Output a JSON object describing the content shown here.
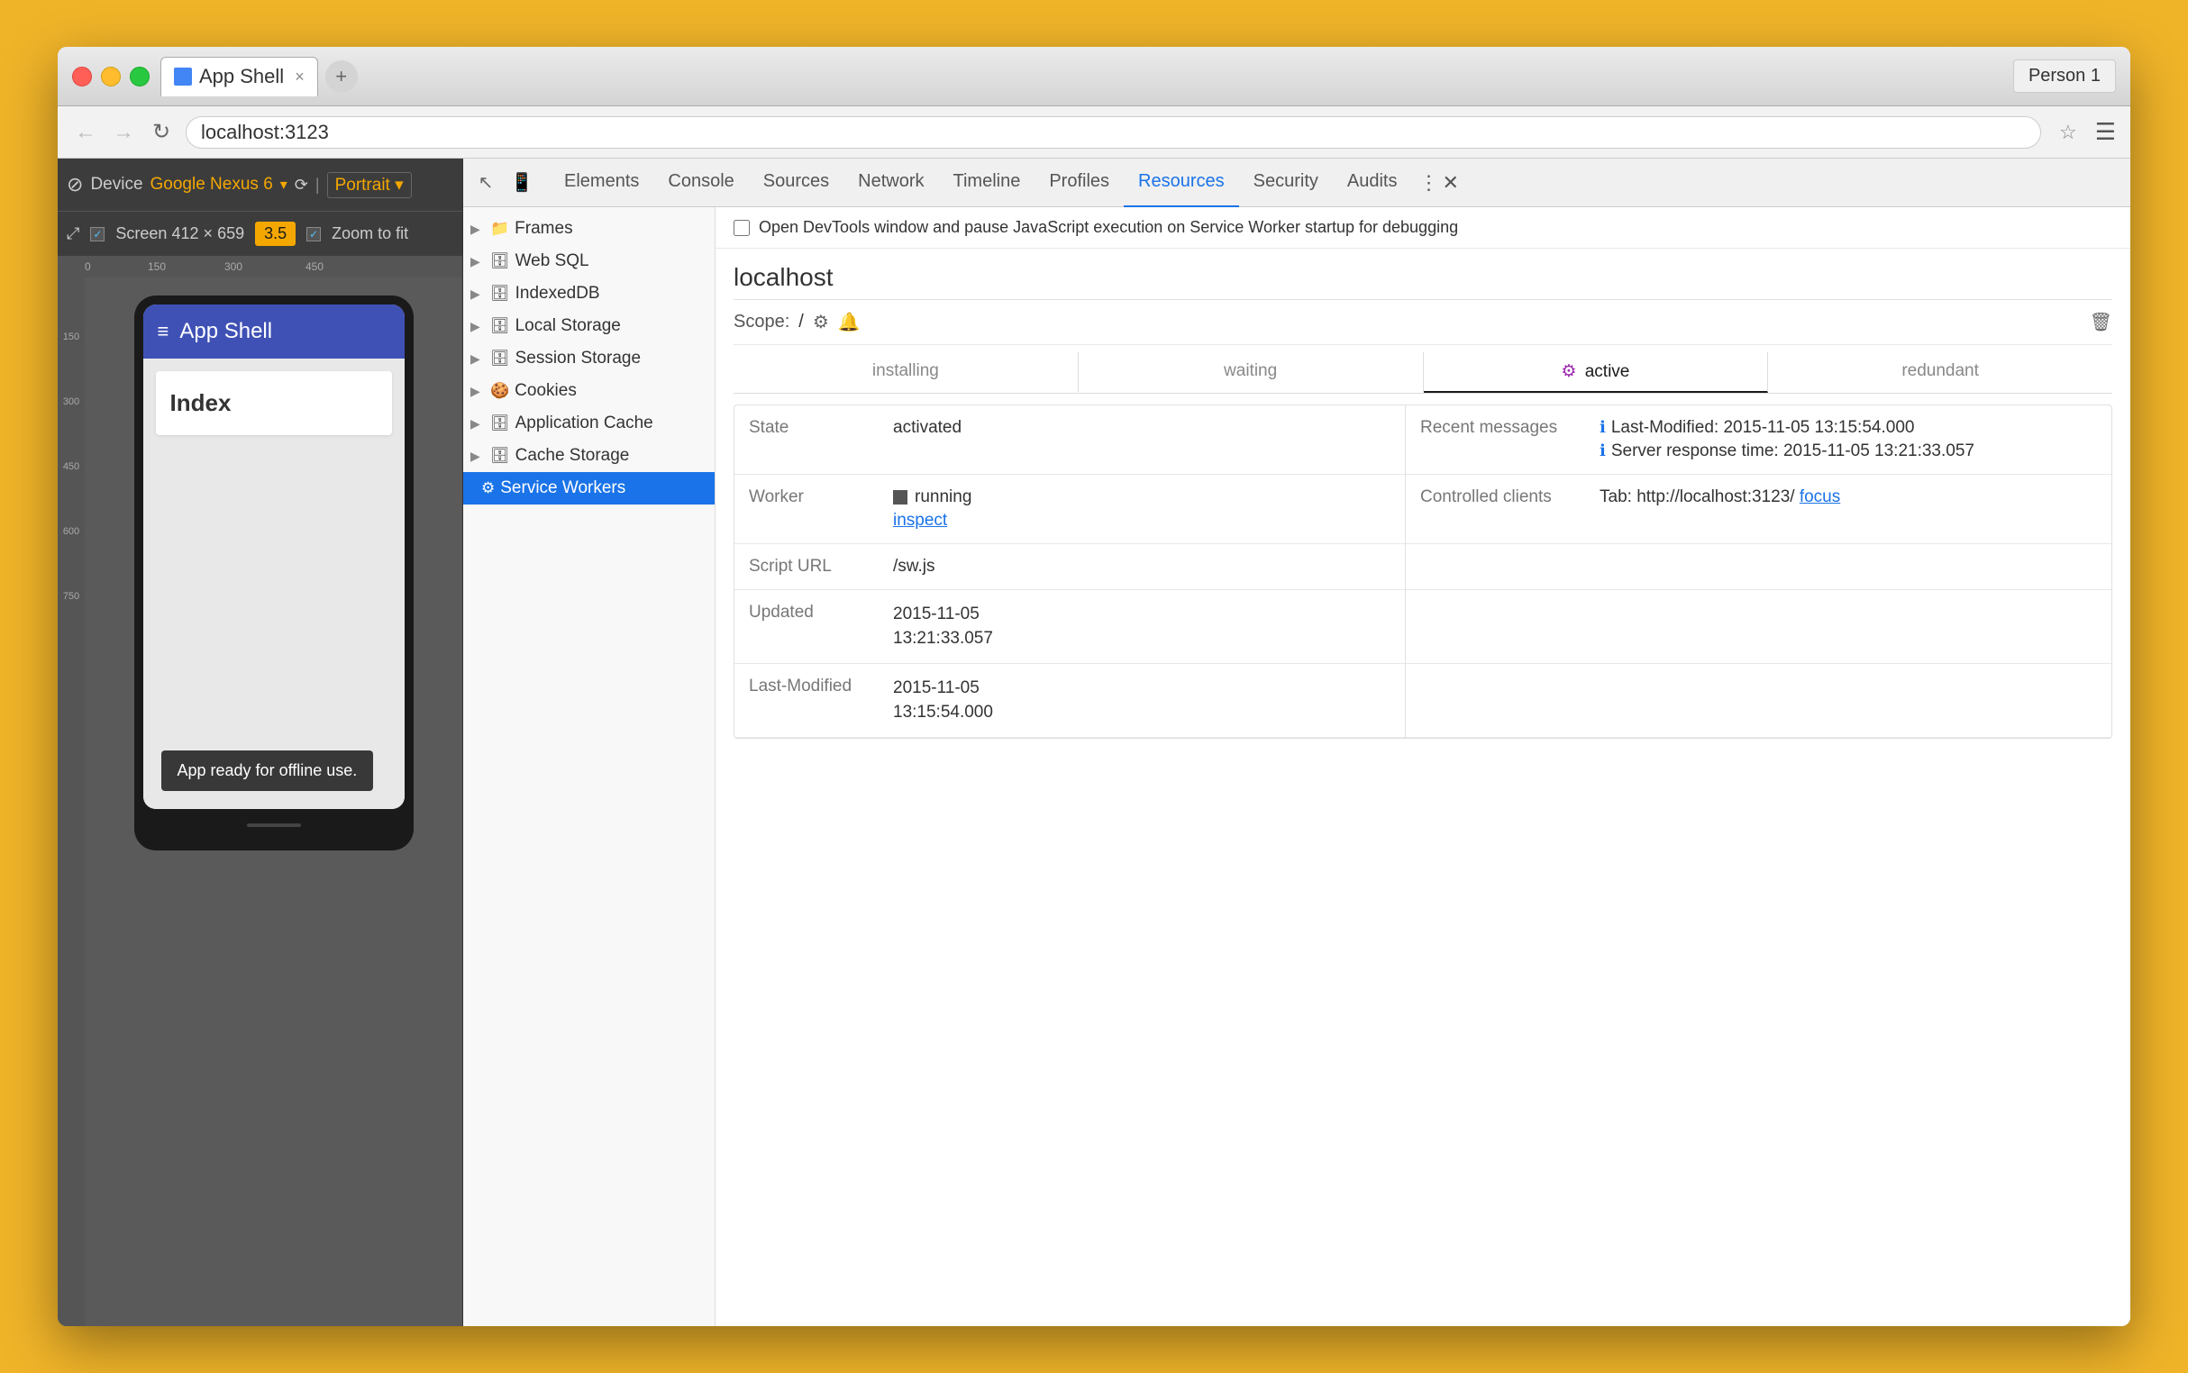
{
  "window": {
    "profile_btn": "Person 1"
  },
  "titlebar": {
    "tab_title": "App Shell",
    "tab_close": "×",
    "tab_new": "+"
  },
  "urlbar": {
    "url": "localhost:3123",
    "back": "←",
    "forward": "→",
    "refresh": "↻"
  },
  "device_toolbar": {
    "device_label": "Device",
    "device_name": "Google Nexus 6",
    "portrait_label": "Portrait ▾",
    "screen_label": "Screen",
    "screen_w": "412",
    "screen_x": "×",
    "screen_h": "659",
    "zoom_label": "3.5",
    "zoom_to_fit_label": "Zoom to fit"
  },
  "device_app": {
    "hamburger": "≡",
    "app_title": "App Shell",
    "index_card": "Index",
    "offline_msg": "App ready for offline use."
  },
  "ruler": {
    "h_ticks": [
      "0",
      "150",
      "300",
      "450"
    ],
    "v_ticks": [
      "150",
      "300",
      "450",
      "600",
      "750"
    ]
  },
  "devtools": {
    "tabs": [
      {
        "label": "Elements"
      },
      {
        "label": "Console"
      },
      {
        "label": "Sources"
      },
      {
        "label": "Network"
      },
      {
        "label": "Timeline"
      },
      {
        "label": "Profiles"
      },
      {
        "label": "Resources",
        "active": true
      },
      {
        "label": "Security"
      },
      {
        "label": "Audits"
      }
    ]
  },
  "resources_sidebar": {
    "items": [
      {
        "label": "Frames",
        "icon": "📁",
        "hasChildren": true,
        "expanded": false
      },
      {
        "label": "Web SQL",
        "icon": "🗄️",
        "hasChildren": true,
        "expanded": false
      },
      {
        "label": "IndexedDB",
        "icon": "🗄️",
        "hasChildren": true,
        "expanded": false
      },
      {
        "label": "Local Storage",
        "icon": "🗄️",
        "hasChildren": true,
        "expanded": false
      },
      {
        "label": "Session Storage",
        "icon": "🗄️",
        "hasChildren": true,
        "expanded": false
      },
      {
        "label": "Cookies",
        "icon": "🍪",
        "hasChildren": true,
        "expanded": false
      },
      {
        "label": "Application Cache",
        "icon": "🗄️",
        "hasChildren": true,
        "expanded": false
      },
      {
        "label": "Cache Storage",
        "icon": "🗄️",
        "hasChildren": true,
        "expanded": false
      },
      {
        "label": "Service Workers",
        "icon": "⚙️",
        "hasChildren": false,
        "selected": true
      }
    ]
  },
  "sw_panel": {
    "checkbox_label": "Open DevTools window and pause JavaScript execution on Service Worker startup for debugging",
    "host_title": "localhost",
    "scope_label": "Scope:",
    "scope_value": "/",
    "status_tabs": [
      {
        "label": "installing"
      },
      {
        "label": "waiting"
      },
      {
        "label": "active",
        "active": true,
        "dot": true
      },
      {
        "label": "redundant"
      }
    ],
    "state_label": "State",
    "state_value": "activated",
    "recent_msg_label": "Recent messages",
    "msg1": "Last-Modified: 2015-11-05 13:15:54.000",
    "msg2": "Server response time: 2015-11-05 13:21:33.057",
    "worker_label": "Worker",
    "worker_running": "running",
    "worker_inspect": "inspect",
    "controlled_clients_label": "Controlled clients",
    "tab_label": "Tab: http://localhost:3123/",
    "tab_focus_link": "focus",
    "script_url_label": "Script URL",
    "script_url_value": "/sw.js",
    "updated_label": "Updated",
    "updated_value": "2015-11-05\n13:21:33.057",
    "last_modified_label": "Last-Modified",
    "last_modified_value": "2015-11-05\n13:15:54.000"
  }
}
